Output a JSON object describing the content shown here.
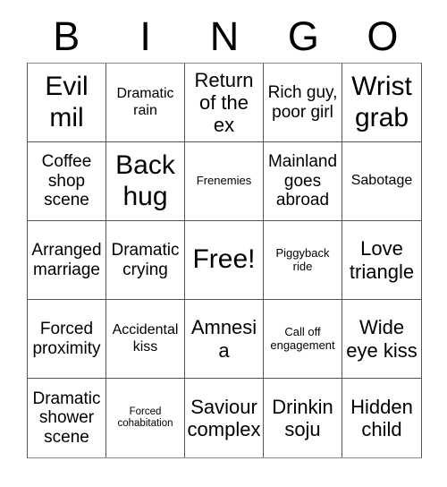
{
  "card": {
    "header_letters": [
      "B",
      "I",
      "N",
      "G",
      "O"
    ],
    "rows": [
      [
        {
          "text": "Evil mil",
          "size": "fs-xxl"
        },
        {
          "text": "Dramatic rain",
          "size": "fs-s"
        },
        {
          "text": "Return of the ex",
          "size": "fs-l"
        },
        {
          "text": "Rich guy, poor girl",
          "size": "fs-m"
        },
        {
          "text": "Wrist grab",
          "size": "fs-xxl"
        }
      ],
      [
        {
          "text": "Coffee shop scene",
          "size": "fs-m"
        },
        {
          "text": "Back hug",
          "size": "fs-xxl"
        },
        {
          "text": "Frenemies",
          "size": "fs-xs"
        },
        {
          "text": "Mainland goes abroad",
          "size": "fs-m"
        },
        {
          "text": "Sabotage",
          "size": "fs-s"
        }
      ],
      [
        {
          "text": "Arranged marriage",
          "size": "fs-m"
        },
        {
          "text": "Dramatic crying",
          "size": "fs-m"
        },
        {
          "text": "Free!",
          "size": "fs-xxl"
        },
        {
          "text": "Piggyback ride",
          "size": "fs-xs"
        },
        {
          "text": "Love triangle",
          "size": "fs-l"
        }
      ],
      [
        {
          "text": "Forced proximity",
          "size": "fs-m"
        },
        {
          "text": "Accidental kiss",
          "size": "fs-s"
        },
        {
          "text": "Amnesia",
          "size": "fs-l"
        },
        {
          "text": "Call off engagement",
          "size": "fs-xs"
        },
        {
          "text": "Wide eye kiss",
          "size": "fs-l"
        }
      ],
      [
        {
          "text": "Dramatic shower scene",
          "size": "fs-m"
        },
        {
          "text": "Forced cohabitation",
          "size": "fs-xxs"
        },
        {
          "text": "Saviour complex",
          "size": "fs-l"
        },
        {
          "text": "Drinkin soju",
          "size": "fs-l"
        },
        {
          "text": "Hidden child",
          "size": "fs-l"
        }
      ]
    ]
  },
  "colors": {
    "background": "#ffffff",
    "text": "#000000",
    "border": "#555555"
  }
}
